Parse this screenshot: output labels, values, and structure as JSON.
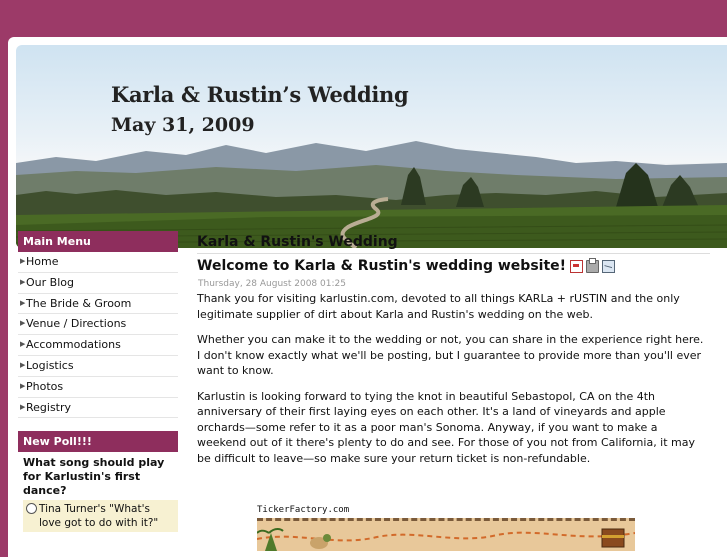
{
  "header": {
    "title": "Karla & Rustin’s Wedding",
    "date": "May 31, 2009"
  },
  "sidebar": {
    "menu_title": "Main Menu",
    "items": [
      {
        "label": "Home"
      },
      {
        "label": "Our Blog"
      },
      {
        "label": "The Bride & Groom"
      },
      {
        "label": "Venue / Directions"
      },
      {
        "label": "Accommodations"
      },
      {
        "label": "Logistics"
      },
      {
        "label": "Photos"
      },
      {
        "label": "Registry"
      }
    ],
    "poll_title": "New Poll!!!",
    "poll_question": "What song should play for Karlustin's first dance?",
    "poll_options": [
      {
        "label": "Tina Turner's \"What's love got to do with it?\""
      }
    ]
  },
  "content": {
    "section_title": "Karla & Rustin's Wedding",
    "article_title": "Welcome to Karla & Rustin's wedding website!",
    "meta": "Thursday, 28 August 2008 01:25",
    "paragraphs": [
      "Thank you for visiting karlustin.com, devoted to all things KARLa + rUSTIN and the only legitimate supplier of dirt about Karla and Rustin's wedding on the web.",
      "Whether you can make it to the wedding or not, you can share in the experience right here. I don't know exactly what we'll be posting, but I guarantee to provide more than you'll ever want to know.",
      "Karlustin is looking forward to tying the knot in beautiful Sebastopol, CA on the 4th anniversary of their first laying eyes on each other. It's a land of vineyards and apple orchards—some refer to it as a poor man's Sonoma. Anyway, if you want to make a weekend out of it there's plenty to do and see. For those of you not from California, it may be difficult to leave—so make sure your return ticket is non-refundable."
    ],
    "ticker_label": "TickerFactory.com"
  },
  "colors": {
    "background": "#9c3a68",
    "menu_header": "#8e2e5d",
    "poll_option_bg": "#f7f1d2"
  }
}
